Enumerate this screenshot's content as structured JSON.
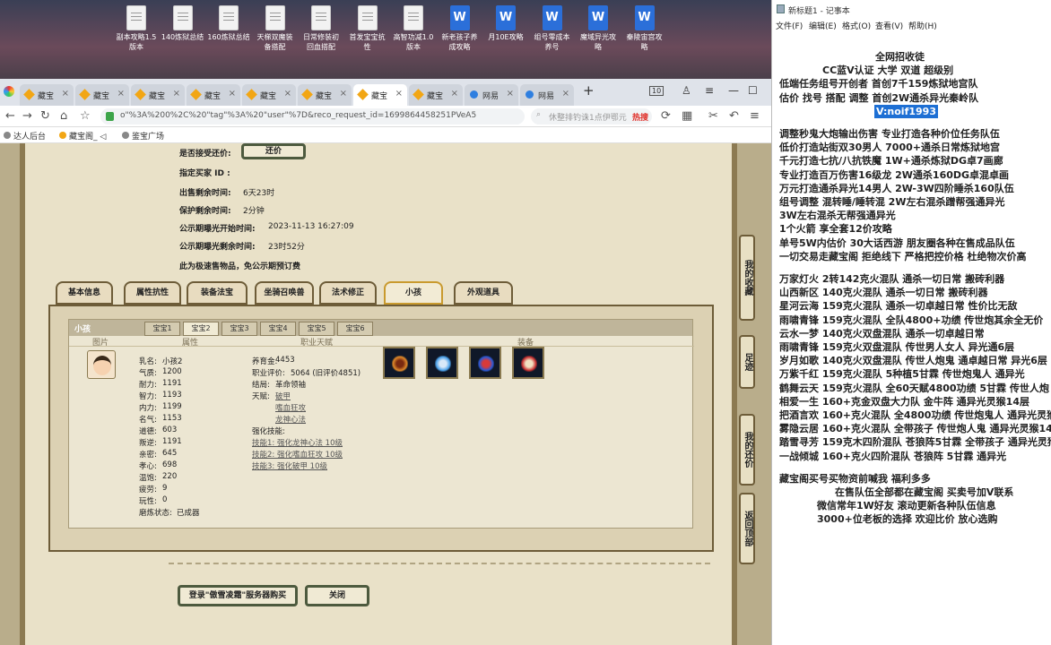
{
  "desktop": {
    "icons": [
      {
        "name": "副本攻略1.5\n版本",
        "type": "txt"
      },
      {
        "name": "140炼狱总结",
        "type": "txt"
      },
      {
        "name": "160炼狱总结",
        "type": "txt"
      },
      {
        "name": "天梯双魔装\n备搭配",
        "type": "txt"
      },
      {
        "name": "日常修装初\n回血搭配",
        "type": "txt"
      },
      {
        "name": "首发宝宝抗\n性",
        "type": "txt"
      },
      {
        "name": "高智功减1.0\n版本",
        "type": "txt"
      },
      {
        "name": "新老孩子养\n成攻略",
        "type": "doc"
      },
      {
        "name": "月10E攻略",
        "type": "doc"
      },
      {
        "name": "组号零成本\n养号",
        "type": "doc"
      },
      {
        "name": "魔域异光攻\n略",
        "type": "doc"
      },
      {
        "name": "秦陵宙宫攻\n略",
        "type": "doc"
      }
    ]
  },
  "browser": {
    "tabs": [
      {
        "label": "藏宝",
        "icon": "cbg"
      },
      {
        "label": "藏宝",
        "icon": "cbg"
      },
      {
        "label": "藏宝",
        "icon": "cbg"
      },
      {
        "label": "藏宝",
        "icon": "cbg"
      },
      {
        "label": "藏宝",
        "icon": "cbg"
      },
      {
        "label": "藏宝",
        "icon": "cbg"
      },
      {
        "label": "藏宝",
        "icon": "cbg"
      },
      {
        "label": "藏宝",
        "icon": "cbg"
      },
      {
        "label": "网易",
        "icon": "net"
      },
      {
        "label": "网易",
        "icon": "net"
      }
    ],
    "tab_count": "10",
    "url": "o\"%3A%200%2C%20\"tag\"%3A%20\"user\"%7D&reco_request_id=1699864458251PVeA5",
    "search_placeholder": "休整排钓诛1点伊鄂元",
    "search_hot": "热搜",
    "bookmarks": [
      "达人后台",
      "藏宝阁_ ◁",
      "鉴宝广场"
    ]
  },
  "listing": {
    "bargain_label": "是否接受还价:",
    "bargain_button": "还价",
    "buyer_id_label": "指定买家 ID :",
    "remaining_label": "出售剩余时间:",
    "remaining_value": "6天23时",
    "protect_label": "保护剩余时间:",
    "protect_value": "2分钟",
    "public_start_label": "公示期曝光开始时间:",
    "public_start_value": "2023-11-13 16:27:09",
    "public_remaining_label": "公示期曝光剩余时间:",
    "public_remaining_value": "23时52分",
    "fast_note": "此为极速售物品，免公示期预订费"
  },
  "main_tabs": [
    "基本信息",
    "属性抗性",
    "装备法宝",
    "坐骑召唤兽",
    "法术修正",
    "小孩",
    "外观道具"
  ],
  "child": {
    "panel_title": "小孩",
    "sub_tabs": [
      "宝宝1",
      "宝宝2",
      "宝宝3",
      "宝宝4",
      "宝宝5",
      "宝宝6"
    ],
    "columns": [
      "图片",
      "属性",
      "职业天赋",
      "装备"
    ],
    "stats": [
      [
        "乳名:",
        "小孩2"
      ],
      [
        "气质:",
        "1200"
      ],
      [
        "耐力:",
        "1191"
      ],
      [
        "智力:",
        "1193"
      ],
      [
        "内力:",
        "1199"
      ],
      [
        "名气:",
        "1153"
      ],
      [
        "道德:",
        "603"
      ],
      [
        "叛逆:",
        "1191"
      ],
      [
        "亲密:",
        "645"
      ],
      [
        "孝心:",
        "698"
      ],
      [
        "温饱:",
        "220"
      ],
      [
        "疲劳:",
        "9"
      ],
      [
        "玩性:",
        "0"
      ],
      [
        "磨炼状态:",
        "已成器"
      ]
    ],
    "career": [
      [
        "养育金:",
        "4453"
      ],
      [
        "职业评价:",
        "5064 (旧评价4851)"
      ],
      [
        "结局:",
        "革命领袖"
      ],
      [
        "天赋:",
        "破甲"
      ]
    ],
    "talents": [
      "嗜血狂攻",
      "龙神心法"
    ],
    "skills_label": "强化技能:",
    "skills": [
      "技能1: 强化龙神心法 10级",
      "技能2: 强化嗜血狂攻 10级",
      "技能3: 强化破甲 10级"
    ],
    "equip_icons": [
      "chest-item-icon",
      "blue-armor-item-icon",
      "blue-relic-item-icon",
      "red-chest-item-icon"
    ]
  },
  "bottom_buttons": {
    "login": "登录\"傲雪凌霜\"服务器购买",
    "close": "关闭"
  },
  "side_buttons": [
    "我的收藏",
    "足迹",
    "我的还价",
    "返回顶部"
  ],
  "notepad": {
    "title": "新标题1 - 记事本",
    "menu": [
      "文件(F)",
      "编辑(E)",
      "格式(O)",
      "查看(V)",
      "帮助(H)"
    ],
    "lines": [
      "全网招收徒",
      "CC蓝V认证 大学 双道 超级别",
      "低端任务组号开创者        首创7千159炼狱地宫队",
      "估价 找号 搭配 调整        首创2W通杀异光秦岭队",
      "V:noif1993",
      "",
      "调整秒鬼大炮输出伤害        专业打造各种价位任务队伍",
      "低价打造站街双30男人         7000+通杀日常炼狱地宫",
      "千元打造七抗/八抗铁魔        1W+通杀炼狱DG卓7画廊",
      "专业打造百万伤害16级龙        2W通杀160DG卓混卓画",
      "万元打造通杀异光14男人       2W-3W四阶睡杀160队伍",
      "组号调整 混转睡/睡转混        2W左右混杀蹭帮强通异光",
      "                                   3W左右混杀无帮强通异光",
      "1个火箭 享全套12价攻略",
      "单号5W内估价 30大话西游       朋友圈各种在售成品队伍",
      "一切交易走藏宝阁 拒绝线下    严格把控价格 杜绝物次价高",
      "",
      "万家灯火 2转142克火混队 通杀一切日常 搬砖利器",
      "山西新区 140克火混队 通杀一切日常 搬砖利器",
      "星河云海 159克火混队 通杀一切卓越日常 性价比无敌",
      "雨啸青锋 159克火混队 全队4800+功绩 传世炮其余全无价",
      "云水一梦 140克火双盘混队 通杀一切卓越日常",
      "雨啸青锋 159克火双盘混队 传世男人女人 异光通6层",
      "岁月如歌 140克火双盘混队 传世人炮鬼 通卓越日常 异光6层",
      "万紫千红 159克火混队 5种植5甘霖 传世炮鬼人 通异光",
      "鹤舞云天 159克火混队 全60天赋4800功绩 5甘霖 传世人炮",
      "相爱一生 160+克金双盘大力队 金牛阵 通异光灵猴14层",
      "把酒言欢 160+克火混队 全4800功绩 传世炮鬼人 通异光灵猴",
      "雾隐云居 160+克火混队 全带孩子 传世炮人鬼 通异光灵猴14",
      "踏雪寻芳 159克木四阶混队 苍狼阵5甘霖 全带孩子 通异光灵猴",
      "一战倾城 160+克火四阶混队 苍狼阵 5甘霖 通异光",
      "",
      "藏宝阁买号买物资前喊我 福利多多",
      "在售队伍全部都在藏宝阁 买卖号加V联系",
      "微信常年1W好友 滚动更新各种队伍信息",
      "3000+位老板的选择 欢迎比价 放心选购"
    ]
  }
}
